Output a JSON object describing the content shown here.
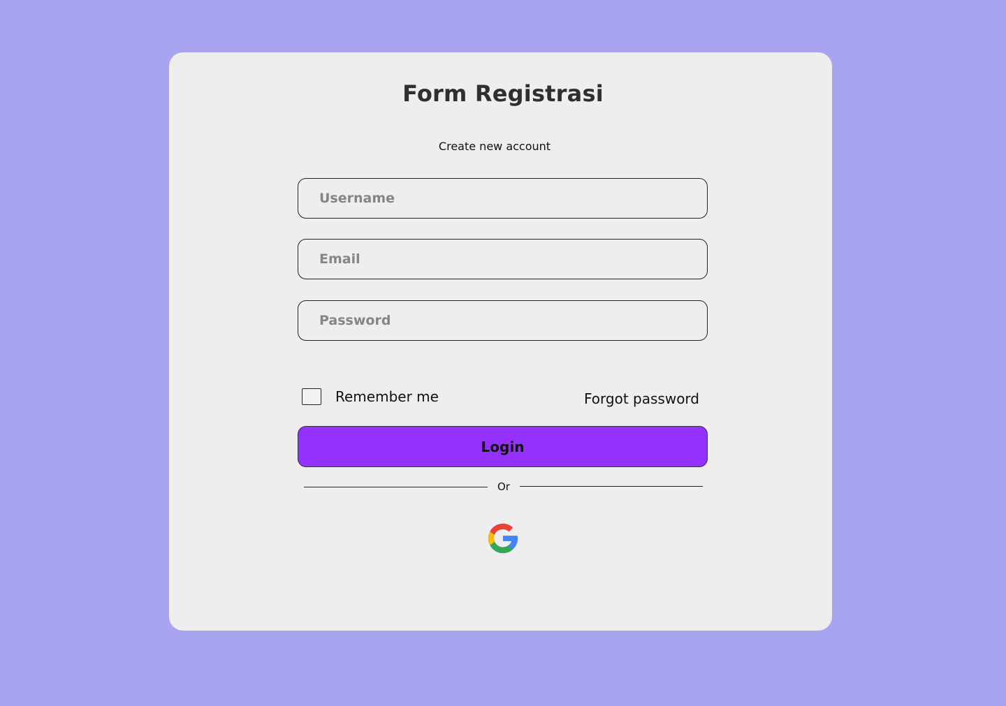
{
  "header": {
    "title": "Form Registrasi",
    "subtitle": "Create new account"
  },
  "form": {
    "username": {
      "value": "",
      "placeholder": "Username"
    },
    "email": {
      "value": "",
      "placeholder": "Email"
    },
    "password": {
      "value": "",
      "placeholder": "Password"
    },
    "remember_label": "Remember me",
    "remember_checked": false,
    "forgot_label": "Forgot password",
    "login_label": "Login"
  },
  "divider": {
    "label": "Or"
  },
  "social": {
    "google_icon": "google-icon"
  },
  "colors": {
    "background": "#A8A4F0",
    "card": "#EEEEEE",
    "accent": "#9531FF",
    "google_blue": "#4285F4",
    "google_red": "#EA4335",
    "google_yellow": "#FBBC05",
    "google_green": "#34A853"
  }
}
